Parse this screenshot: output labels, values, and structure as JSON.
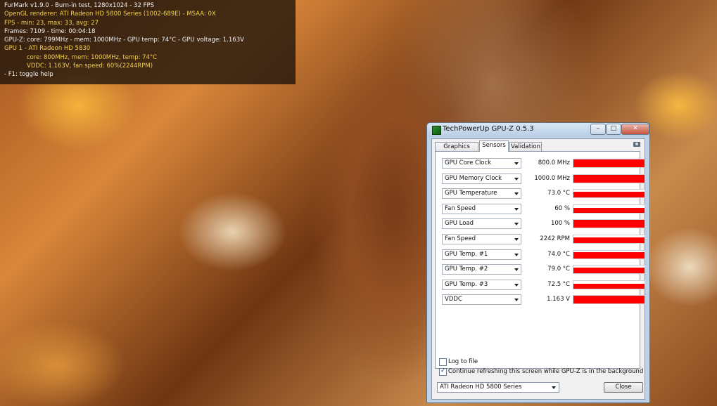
{
  "furmark": {
    "line1": "FurMark v1.9.0 - Burn-in test, 1280x1024 - 32 FPS",
    "line2": "OpenGL renderer: ATI Radeon HD 5800 Series  (1002-689E) - MSAA: 0X",
    "line3": "FPS - min: 23, max: 33, avg: 27",
    "line4": "Frames: 7109 - time: 00:04:18",
    "line5": "GPU-Z: core: 799MHz - mem: 1000MHz - GPU temp: 74°C - GPU voltage: 1.163V",
    "line6": "GPU 1 - ATI Radeon HD 5830",
    "line7": "core: 800MHz, mem: 1000MHz, temp: 74°C",
    "line8": "VDDC: 1.163V, fan speed: 60%(2244RPM)",
    "line9": "- F1: toggle help"
  },
  "window": {
    "title": "TechPowerUp GPU-Z 0.5.3",
    "min_glyph": "–",
    "max_glyph": "□",
    "close_glyph": "✕"
  },
  "tabs": {
    "graphics": "Graphics Card",
    "sensors": "Sensors",
    "validation": "Validation"
  },
  "sensors": [
    {
      "name": "GPU Core Clock",
      "value": "800.0 MHz",
      "level": 1.0
    },
    {
      "name": "GPU Memory Clock",
      "value": "1000.0 MHz",
      "level": 1.0
    },
    {
      "name": "GPU Temperature",
      "value": "73.0 °C",
      "level": 0.75
    },
    {
      "name": "Fan Speed",
      "value": "60 %",
      "level": 0.6
    },
    {
      "name": "GPU Load",
      "value": "100 %",
      "level": 1.0
    },
    {
      "name": "Fan Speed",
      "value": "2242 RPM",
      "level": 0.7
    },
    {
      "name": "GPU Temp. #1",
      "value": "74.0 °C",
      "level": 0.75
    },
    {
      "name": "GPU Temp. #2",
      "value": "79.0 °C",
      "level": 0.72
    },
    {
      "name": "GPU Temp. #3",
      "value": "72.5 °C",
      "level": 0.65
    },
    {
      "name": "VDDC",
      "value": "1.163 V",
      "level": 1.0
    }
  ],
  "options": {
    "log_to_file": "Log to file",
    "log_checked": false,
    "continue_refresh": "Continue refreshing this screen while GPU-Z is in the background",
    "refresh_checked": true,
    "check_glyph": "✓"
  },
  "device_select": "ATI Radeon HD 5800 Series",
  "close_button": "Close",
  "colors": {
    "graph_fill": "#ff0000",
    "osd_text_white": "#f0f0f0",
    "osd_text_yellow": "#f3d24c"
  }
}
